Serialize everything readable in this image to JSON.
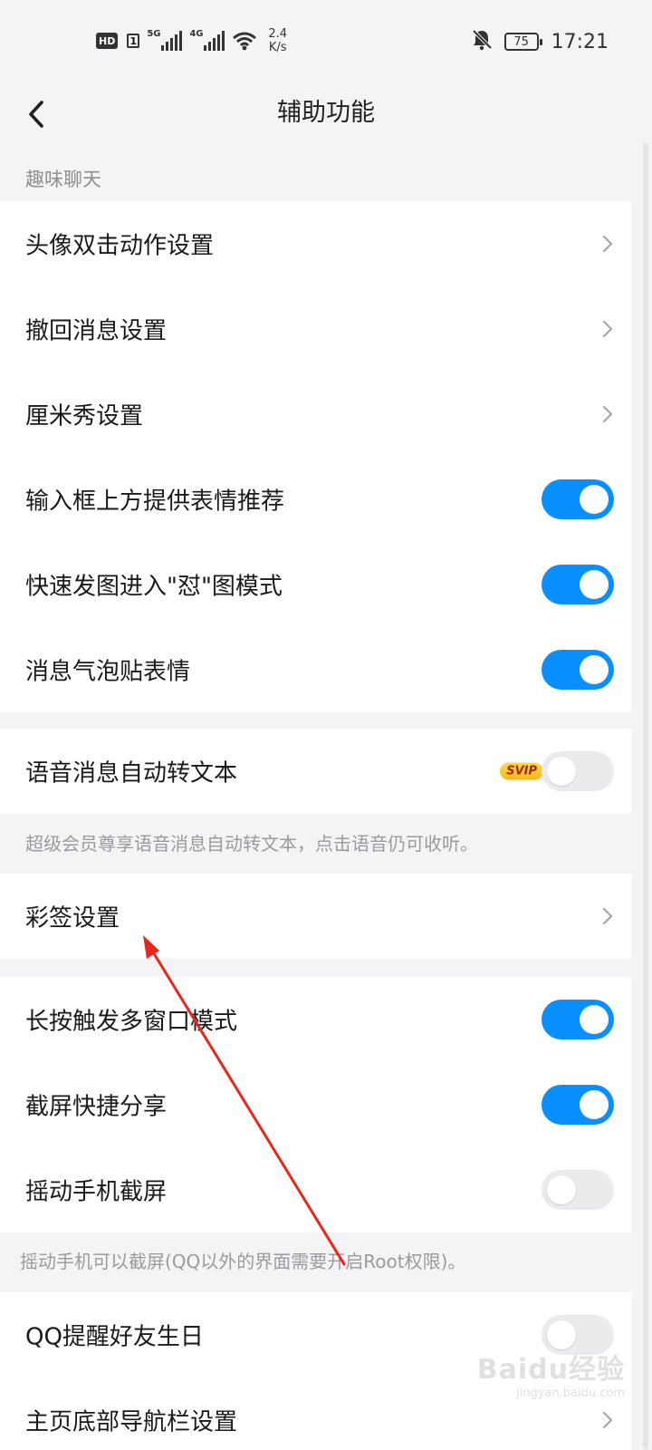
{
  "status_bar": {
    "hd": "HD",
    "sim": "1",
    "signal1": "5G",
    "signal2": "4G",
    "speed_value": "2.4",
    "speed_unit": "K/s",
    "battery": "75",
    "time": "17:21",
    "icons": [
      "bell-muted-icon",
      "wifi-icon",
      "battery-icon"
    ]
  },
  "header": {
    "title": "辅助功能"
  },
  "section_label": "趣味聊天",
  "group1": [
    {
      "label": "头像双击动作设置",
      "control": "chevron"
    },
    {
      "label": "撤回消息设置",
      "control": "chevron"
    },
    {
      "label": "厘米秀设置",
      "control": "chevron"
    },
    {
      "label": "输入框上方提供表情推荐",
      "control": "toggle",
      "on": true
    },
    {
      "label": "快速发图进入\"怼\"图模式",
      "control": "toggle",
      "on": true
    },
    {
      "label": "消息气泡贴表情",
      "control": "toggle",
      "on": true
    }
  ],
  "voice": {
    "label": "语音消息自动转文本",
    "badge": "SVIP",
    "on": false
  },
  "voice_hint": "超级会员尊享语音消息自动转文本，点击语音仍可收听。",
  "signature": {
    "label": "彩签设置"
  },
  "group3": [
    {
      "label": "长按触发多窗口模式",
      "on": true
    },
    {
      "label": "截屏快捷分享",
      "on": true
    },
    {
      "label": "摇动手机截屏",
      "on": false
    }
  ],
  "shake_hint": "摇动手机可以截屏(QQ以外的界面需要开启Root权限)。",
  "group4": [
    {
      "label": "QQ提醒好友生日",
      "on": false
    },
    {
      "label": "主页底部导航栏设置"
    }
  ],
  "watermark": {
    "main": "Baidu经验",
    "sub": "jingyan.baidu.com"
  },
  "colors": {
    "accent": "#0a8fff",
    "annotation": "#e8261b"
  }
}
